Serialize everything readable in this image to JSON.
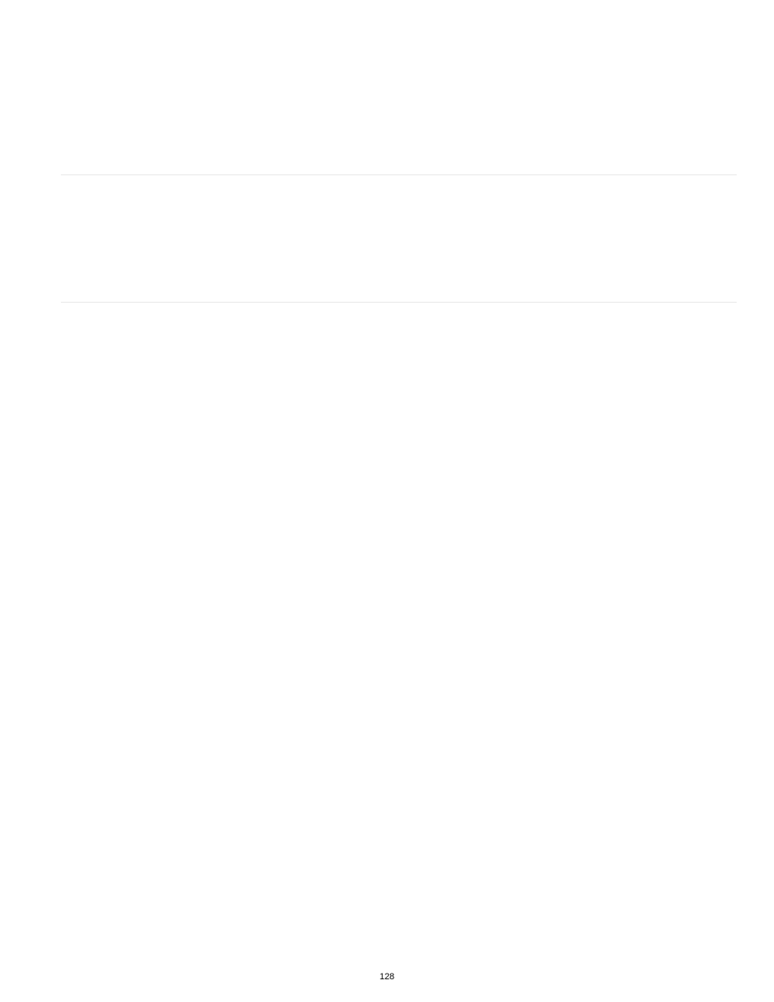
{
  "page": {
    "number": "128"
  }
}
